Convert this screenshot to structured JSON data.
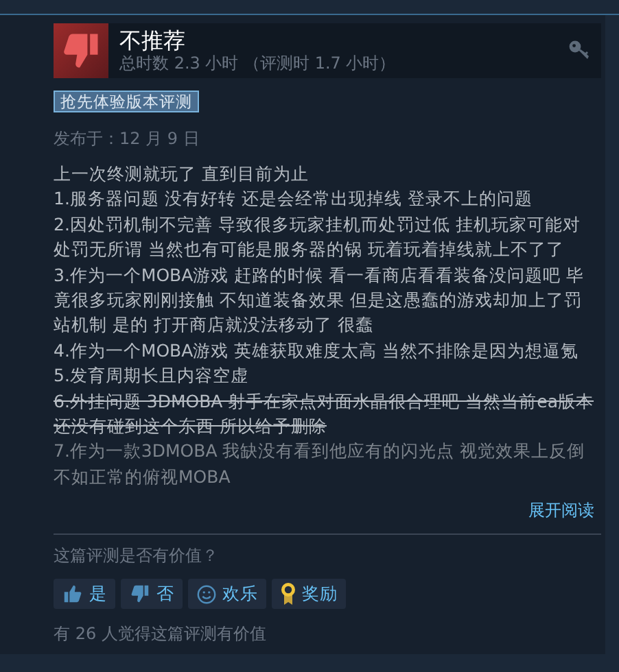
{
  "review": {
    "verdict": "不推荐",
    "recommended": false,
    "playtime": "总时数 2.3 小时 （评测时 1.7 小时）",
    "tag": "抢先体验版本评测",
    "posted": "发布于：12 月 9 日",
    "paragraphs": [
      {
        "text": "上一次终测就玩了 直到目前为止",
        "struck": false
      },
      {
        "text": "1.服务器问题 没有好转 还是会经常出现掉线 登录不上的问题",
        "struck": false
      },
      {
        "text": "2.因处罚机制不完善 导致很多玩家挂机而处罚过低 挂机玩家可能对处罚无所谓 当然也有可能是服务器的锅 玩着玩着掉线就上不了了",
        "struck": false
      },
      {
        "text": "3.作为一个MOBA游戏 赶路的时候 看一看商店看看装备没问题吧 毕竟很多玩家刚刚接触 不知道装备效果 但是这愚蠢的游戏却加上了罚站机制 是的 打开商店就没法移动了 很蠢",
        "struck": false
      },
      {
        "text": "4.作为一个MOBA游戏 英雄获取难度太高 当然不排除是因为想逼氪",
        "struck": false
      },
      {
        "text": "5.发育周期长且内容空虚",
        "struck": false
      },
      {
        "text": "6.外挂问题 3DMOBA 射手在家点对面水晶很合理吧 当然当前ea版本还没有碰到这个东西 所以给予删除",
        "struck": true
      },
      {
        "text": "7.作为一款3DMOBA 我缺没有看到他应有的闪光点 视觉效果上反倒不如正常的俯视MOBA",
        "struck": false
      }
    ],
    "collapsed": true,
    "expand_link": "展开阅读",
    "question": "这篇评测是否有价值？",
    "buttons": [
      {
        "kind": "up",
        "label": "是"
      },
      {
        "kind": "down",
        "label": "否"
      },
      {
        "kind": "funny",
        "label": "欢乐"
      },
      {
        "kind": "award",
        "label": "奖励"
      }
    ],
    "helpful_count": "有 26 人觉得这篇评测有价值"
  }
}
